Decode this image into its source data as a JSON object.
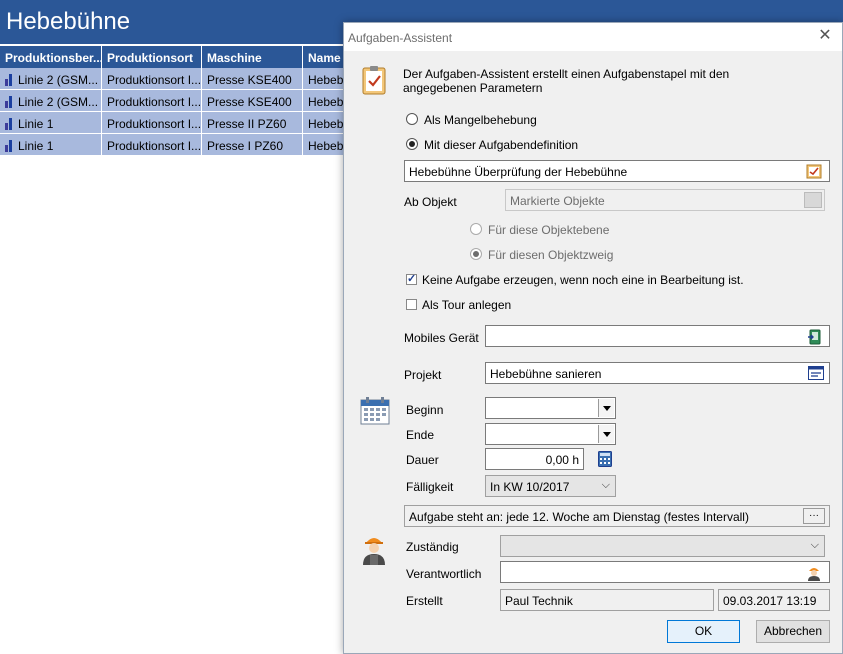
{
  "app": {
    "title": "Hebebühne",
    "columns": [
      "Produktionsber...",
      "Produktionsort",
      "Maschine",
      "Name"
    ],
    "rows": [
      [
        "Linie 2 (GSM...",
        "Produktionsort I...",
        "Presse KSE400",
        "Hebebü"
      ],
      [
        "Linie 2 (GSM...",
        "Produktionsort I...",
        "Presse KSE400",
        "Hebebü"
      ],
      [
        "Linie 1",
        "Produktionsort I...",
        "Presse II PZ60",
        "Hebebü"
      ],
      [
        "Linie 1",
        "Produktionsort I...",
        "Presse I PZ60",
        "Hebebü"
      ]
    ]
  },
  "dialog": {
    "title": "Aufgaben-Assistent",
    "close_glyph": "✕",
    "intro": "Der Aufgaben-Assistent erstellt einen Aufgabenstapel mit den angegebenen Parametern",
    "radio_mangel": "Als Mangelbehebung",
    "radio_definition": "Mit dieser Aufgabendefinition",
    "definition_value": "Hebebühne Überprüfung der Hebebühne",
    "ab_objekt_label": "Ab Objekt",
    "ab_objekt_value": "Markierte Objekte",
    "radio_ebene": "Für diese Objektebene",
    "radio_zweig": "Für diesen Objektzweig",
    "check_keine": "Keine Aufgabe erzeugen, wenn noch eine in Bearbeitung ist.",
    "check_tour": "Als Tour anlegen",
    "mobiles_label": "Mobiles Gerät",
    "mobiles_value": "",
    "projekt_label": "Projekt",
    "projekt_value": "Hebebühne sanieren",
    "beginn_label": "Beginn",
    "beginn_value": "",
    "ende_label": "Ende",
    "ende_value": "",
    "dauer_label": "Dauer",
    "dauer_value": "0,00 h",
    "faelligkeit_label": "Fälligkeit",
    "faelligkeit_value": "In KW 10/2017",
    "interval_text": "Aufgabe steht an: jede 12. Woche am Dienstag  (festes Intervall)",
    "interval_btn": "···",
    "zustaendig_label": "Zuständig",
    "zustaendig_value": "",
    "verantwortlich_label": "Verantwortlich",
    "verantwortlich_value": "",
    "erstellt_label": "Erstellt",
    "erstellt_by": "Paul Technik",
    "erstellt_date": "09.03.2017 13:19",
    "ok_label": "OK",
    "cancel_label": "Abbrechen"
  },
  "colors": {
    "header_blue": "#2b5797",
    "row_selected": "#a8b9dd",
    "dialog_bg": "#f0f0f0",
    "ok_border": "#0078d7"
  }
}
